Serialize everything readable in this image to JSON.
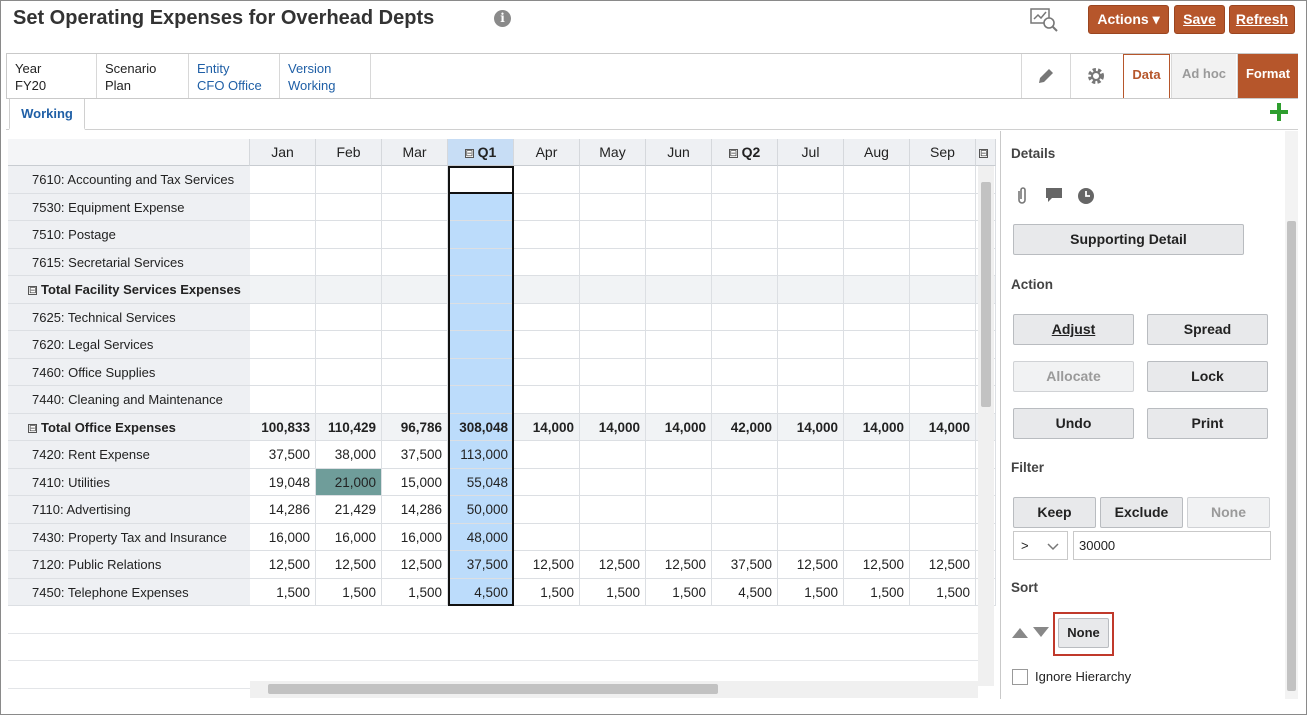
{
  "header": {
    "title": "Set Operating Expenses for Overhead Depts",
    "info_icon_glyph": "i",
    "actions_label": "Actions",
    "save_label": "Save",
    "refresh_label": "Refresh",
    "accent_color": "#b6562b"
  },
  "pov": [
    {
      "label": "Year",
      "value": "FY20",
      "link": false
    },
    {
      "label": "Scenario",
      "value": "Plan",
      "link": false
    },
    {
      "label": "Entity",
      "value": "CFO Office",
      "link": true
    },
    {
      "label": "Version",
      "value": "Working",
      "link": true
    }
  ],
  "view_tabs": {
    "data": "Data",
    "adhoc": "Ad hoc",
    "format": "Format"
  },
  "form_tab": "Working",
  "grid": {
    "columns": [
      "Jan",
      "Feb",
      "Mar",
      "Q1",
      "Apr",
      "May",
      "Jun",
      "Q2",
      "Jul",
      "Aug",
      "Sep"
    ],
    "collapse_glyph": "⊟",
    "rows": [
      {
        "label": "7610: Accounting and Tax Services",
        "total": false,
        "values": [
          "",
          "",
          "",
          "",
          "",
          "",
          "",
          "",
          "",
          "",
          ""
        ]
      },
      {
        "label": "7530: Equipment Expense",
        "total": false,
        "values": [
          "",
          "",
          "",
          "",
          "",
          "",
          "",
          "",
          "",
          "",
          ""
        ]
      },
      {
        "label": "7510: Postage",
        "total": false,
        "values": [
          "",
          "",
          "",
          "",
          "",
          "",
          "",
          "",
          "",
          "",
          ""
        ]
      },
      {
        "label": "7615: Secretarial Services",
        "total": false,
        "values": [
          "",
          "",
          "",
          "",
          "",
          "",
          "",
          "",
          "",
          "",
          ""
        ]
      },
      {
        "label": "Total Facility Services Expenses",
        "total": true,
        "values": [
          "",
          "",
          "",
          "",
          "",
          "",
          "",
          "",
          "",
          "",
          ""
        ]
      },
      {
        "label": "7625: Technical Services",
        "total": false,
        "values": [
          "",
          "",
          "",
          "",
          "",
          "",
          "",
          "",
          "",
          "",
          ""
        ]
      },
      {
        "label": "7620: Legal Services",
        "total": false,
        "values": [
          "",
          "",
          "",
          "",
          "",
          "",
          "",
          "",
          "",
          "",
          ""
        ]
      },
      {
        "label": "7460: Office Supplies",
        "total": false,
        "values": [
          "",
          "",
          "",
          "",
          "",
          "",
          "",
          "",
          "",
          "",
          ""
        ]
      },
      {
        "label": "7440: Cleaning and Maintenance",
        "total": false,
        "values": [
          "",
          "",
          "",
          "",
          "",
          "",
          "",
          "",
          "",
          "",
          ""
        ]
      },
      {
        "label": "Total Office Expenses",
        "total": true,
        "values": [
          "100,833",
          "110,429",
          "96,786",
          "308,048",
          "14,000",
          "14,000",
          "14,000",
          "42,000",
          "14,000",
          "14,000",
          "14,000"
        ]
      },
      {
        "label": "7420: Rent Expense",
        "total": false,
        "values": [
          "37,500",
          "38,000",
          "37,500",
          "113,000",
          "",
          "",
          "",
          "",
          "",
          "",
          ""
        ]
      },
      {
        "label": "7410: Utilities",
        "total": false,
        "values": [
          "19,048",
          "21,000",
          "15,000",
          "55,048",
          "",
          "",
          "",
          "",
          "",
          "",
          ""
        ]
      },
      {
        "label": "7110: Advertising",
        "total": false,
        "values": [
          "14,286",
          "21,429",
          "14,286",
          "50,000",
          "",
          "",
          "",
          "",
          "",
          "",
          ""
        ]
      },
      {
        "label": "7430: Property Tax and Insurance",
        "total": false,
        "values": [
          "16,000",
          "16,000",
          "16,000",
          "48,000",
          "",
          "",
          "",
          "",
          "",
          "",
          ""
        ]
      },
      {
        "label": "7120: Public Relations",
        "total": false,
        "values": [
          "12,500",
          "12,500",
          "12,500",
          "37,500",
          "12,500",
          "12,500",
          "12,500",
          "37,500",
          "12,500",
          "12,500",
          "12,500"
        ]
      },
      {
        "label": "7450: Telephone Expenses",
        "total": false,
        "values": [
          "1,500",
          "1,500",
          "1,500",
          "4,500",
          "1,500",
          "1,500",
          "1,500",
          "4,500",
          "1,500",
          "1,500",
          "1,500"
        ]
      }
    ]
  },
  "panel": {
    "details": "Details",
    "supporting_detail": "Supporting Detail",
    "action": "Action",
    "adjust": "Adjust",
    "spread": "Spread",
    "allocate": "Allocate",
    "lock": "Lock",
    "undo": "Undo",
    "print": "Print",
    "filter": "Filter",
    "keep": "Keep",
    "exclude": "Exclude",
    "filter_none": "None",
    "operator": ">",
    "filter_value": "30000",
    "sort": "Sort",
    "sort_none": "None",
    "ignore_hierarchy": "Ignore Hierarchy"
  }
}
